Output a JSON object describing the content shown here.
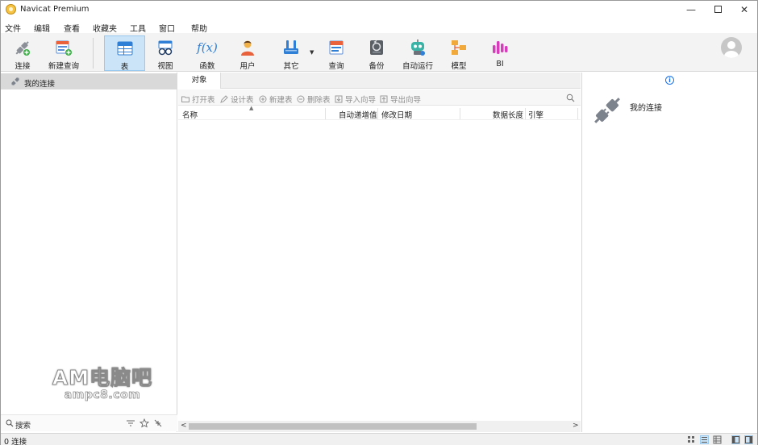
{
  "app": {
    "title": "Navicat Premium"
  },
  "window_controls": {
    "minimize": "—",
    "close": "✕"
  },
  "menu": [
    "文件",
    "编辑",
    "查看",
    "收藏夹",
    "工具",
    "窗口",
    "帮助"
  ],
  "toolbar": {
    "items": [
      {
        "label": "连接",
        "icon": "connection-plug-icon"
      },
      {
        "label": "新建查询",
        "icon": "new-query-icon"
      },
      {
        "label": "表",
        "icon": "table-icon",
        "active": true
      },
      {
        "label": "视图",
        "icon": "view-glasses-icon"
      },
      {
        "label": "函数",
        "icon": "function-fx-icon"
      },
      {
        "label": "用户",
        "icon": "user-icon"
      },
      {
        "label": "其它",
        "icon": "other-tools-icon",
        "has_dropdown": true
      },
      {
        "label": "查询",
        "icon": "query-icon"
      },
      {
        "label": "备份",
        "icon": "backup-icon"
      },
      {
        "label": "自动运行",
        "icon": "automation-robot-icon"
      },
      {
        "label": "模型",
        "icon": "model-icon"
      },
      {
        "label": "BI",
        "icon": "bi-chart-icon"
      }
    ],
    "fx_text": "f(x)"
  },
  "sidebar": {
    "connection_label": "我的连接",
    "search_label": "搜索",
    "watermark": {
      "title": "AM电脑吧",
      "url": "ampc8.com"
    }
  },
  "objects": {
    "tab_label": "对象",
    "actions": [
      "打开表",
      "设计表",
      "新建表",
      "删除表",
      "导入向导",
      "导出向导"
    ],
    "columns": [
      "名称",
      "自动递增值",
      "修改日期",
      "数据长度",
      "引擎"
    ]
  },
  "info_pane": {
    "title": "我的连接",
    "info_glyph": "i"
  },
  "status": {
    "text": "0 连接"
  },
  "colors": {
    "toolbar_bg": "#f3f3f3",
    "active_tool_bg": "#cce4f7",
    "selection_bg": "#d9d9d9",
    "accent_blue": "#1a73e8"
  }
}
